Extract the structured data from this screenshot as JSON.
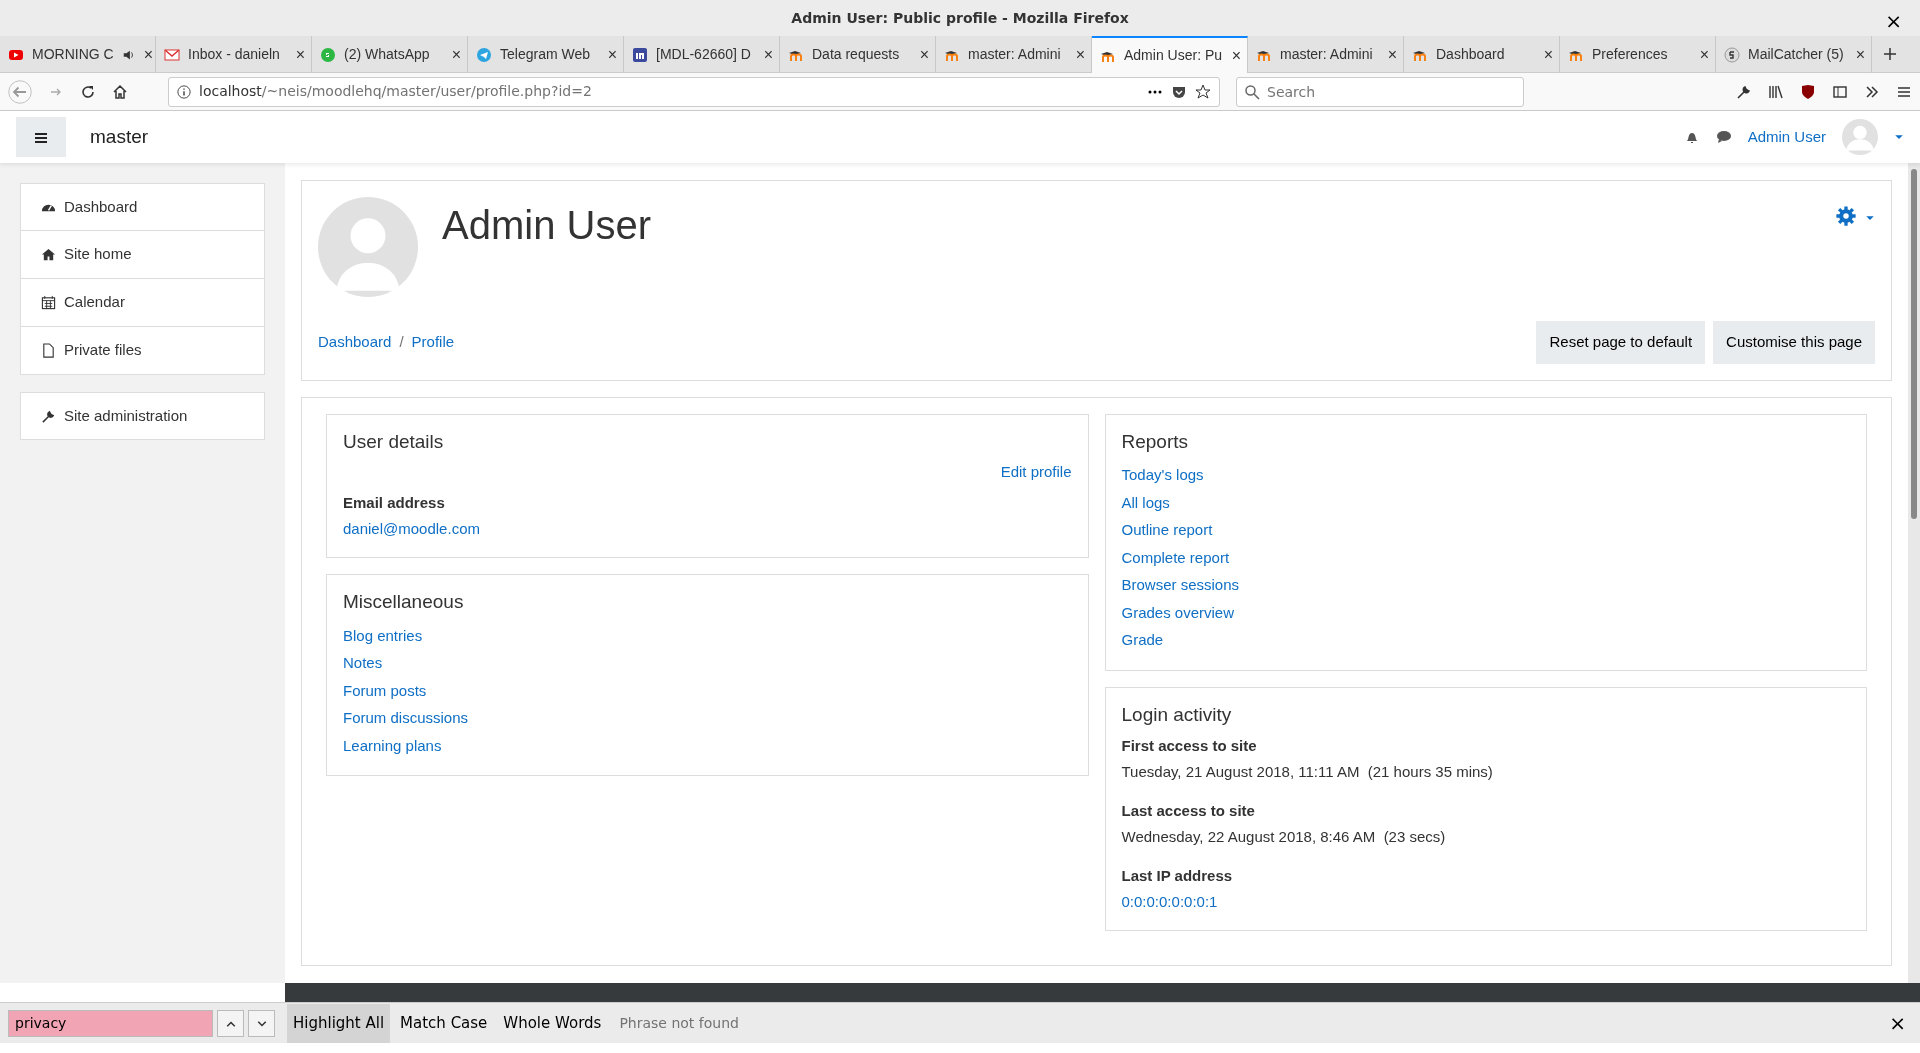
{
  "window": {
    "title": "Admin User: Public profile - Mozilla Firefox",
    "close": "×"
  },
  "tabs": [
    {
      "label": "MORNING C",
      "muted": true,
      "close": "×",
      "selected": false
    },
    {
      "label": "Inbox - danieln",
      "muted": false,
      "close": "×",
      "selected": false
    },
    {
      "label": "(2) WhatsApp",
      "muted": false,
      "close": "×",
      "selected": false
    },
    {
      "label": "Telegram Web",
      "muted": false,
      "close": "×",
      "selected": false
    },
    {
      "label": "[MDL-62660] D",
      "muted": false,
      "close": "×",
      "selected": false
    },
    {
      "label": "Data requests",
      "muted": false,
      "close": "×",
      "selected": false
    },
    {
      "label": "master: Admini",
      "muted": false,
      "close": "×",
      "selected": false
    },
    {
      "label": "Admin User: Pu",
      "muted": false,
      "close": "×",
      "selected": true
    },
    {
      "label": "master: Admini",
      "muted": false,
      "close": "×",
      "selected": false
    },
    {
      "label": "Dashboard",
      "muted": false,
      "close": "×",
      "selected": false
    },
    {
      "label": "Preferences",
      "muted": false,
      "close": "×",
      "selected": false
    },
    {
      "label": "MailCatcher (5)",
      "muted": false,
      "close": "×",
      "selected": false
    }
  ],
  "address_bar": {
    "host": "localhost",
    "path": "/~neis/moodlehq/master/user/profile.php?id=2"
  },
  "search": {
    "placeholder": "Search"
  },
  "site": {
    "name": "master",
    "user": "Admin User"
  },
  "sidebar": {
    "items": [
      "Dashboard",
      "Site home",
      "Calendar",
      "Private files"
    ],
    "admin": "Site administration"
  },
  "header": {
    "name": "Admin User",
    "breadcrumbs": [
      "Dashboard",
      "Profile"
    ],
    "separator": "/",
    "buttons": [
      "Reset page to default",
      "Customise this page"
    ]
  },
  "user_details": {
    "title": "User details",
    "edit": "Edit profile",
    "fields": [
      {
        "label": "Email address",
        "value": "daniel@moodle.com",
        "link": true
      }
    ]
  },
  "miscellaneous": {
    "title": "Miscellaneous",
    "links": [
      "Blog entries",
      "Notes",
      "Forum posts",
      "Forum discussions",
      "Learning plans"
    ]
  },
  "reports": {
    "title": "Reports",
    "links": [
      "Today's logs",
      "All logs",
      "Outline report",
      "Complete report",
      "Browser sessions",
      "Grades overview",
      "Grade"
    ]
  },
  "login_activity": {
    "title": "Login activity",
    "fields": [
      {
        "label": "First access to site",
        "value": "Tuesday, 21 August 2018, 11:11 AM  (21 hours 35 mins)",
        "link": false
      },
      {
        "label": "Last access to site",
        "value": "Wednesday, 22 August 2018, 8:46 AM  (23 secs)",
        "link": false
      },
      {
        "label": "Last IP address",
        "value": "0:0:0:0:0:0:0:1",
        "link": true
      }
    ]
  },
  "find_bar": {
    "value": "privacy",
    "options": [
      {
        "label": "Highlight All",
        "on": true
      },
      {
        "label": "Match Case",
        "on": false
      },
      {
        "label": "Whole Words",
        "on": false
      }
    ],
    "status": "Phrase not found",
    "close": "×"
  }
}
